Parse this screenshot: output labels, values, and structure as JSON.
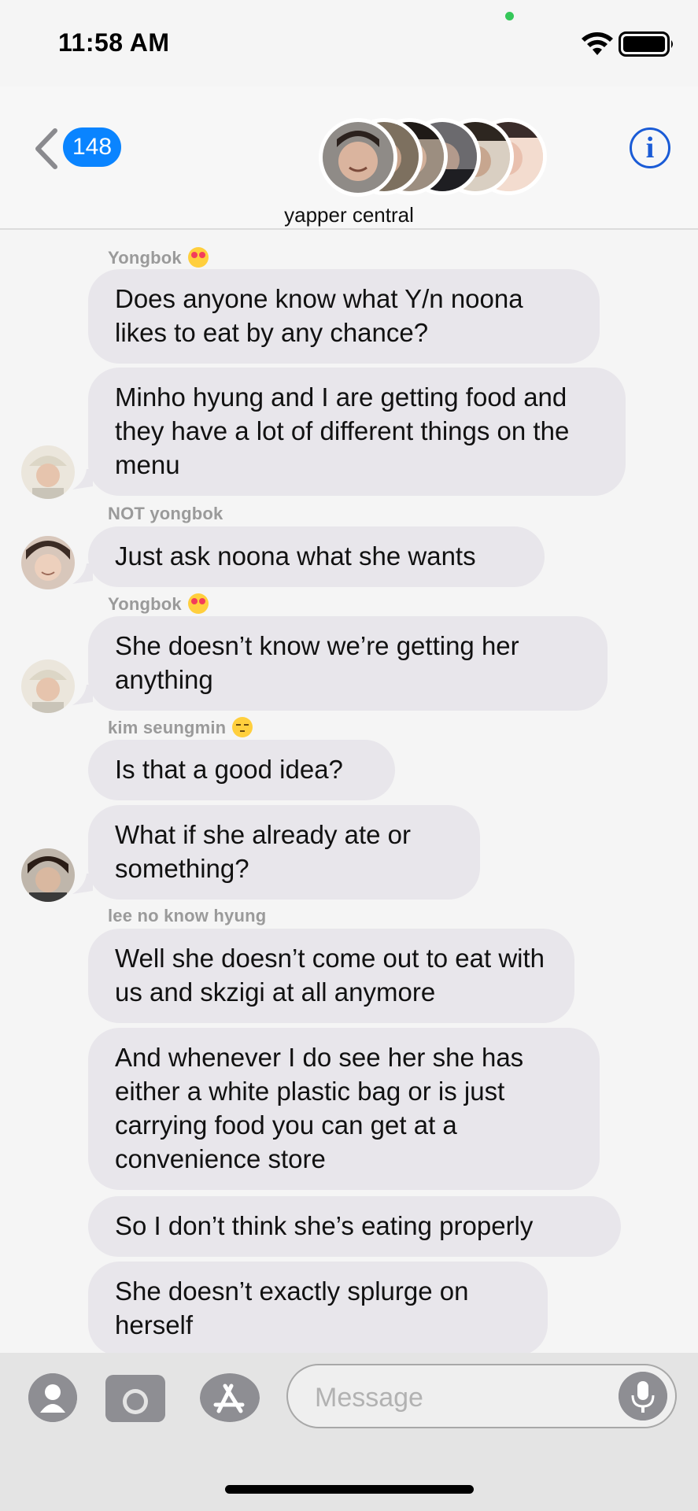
{
  "status": {
    "time": "11:58 AM",
    "battery_level": 1.0
  },
  "header": {
    "back_count": "148",
    "group_name": "yapper central",
    "info_label": "i"
  },
  "messages": [
    {
      "sender": "Yongbok",
      "sender_emoji": "smiling-face-with-hearts",
      "text": "Does anyone know what Y/n noona likes to eat by any chance?"
    },
    {
      "sender": "",
      "text": "Minho hyung and I are getting food and they have a lot of different things on the menu",
      "avatar": "yongbok-avatar"
    },
    {
      "sender": "NOT yongbok",
      "text": "Just ask noona what she wants",
      "avatar": "not-yongbok-avatar"
    },
    {
      "sender": "Yongbok",
      "sender_emoji": "smiling-face-with-hearts",
      "text": "She doesn’t know we’re getting her anything",
      "avatar": "yongbok-avatar"
    },
    {
      "sender": "kim seungmin",
      "sender_emoji": "unamused-face",
      "text": "Is that a good idea?"
    },
    {
      "sender": "",
      "text": "What if she already ate or something?",
      "avatar": "seungmin-avatar"
    },
    {
      "sender": "lee no know hyung",
      "text": "Well she doesn’t come out to eat with us and skzigi at all anymore"
    },
    {
      "sender": "",
      "text": "And whenever I do see her she has either a white plastic bag or is just carrying food you can get at a convenience store"
    },
    {
      "sender": "",
      "text": "So I don’t think she’s eating properly"
    },
    {
      "sender": "",
      "text": "She doesn’t exactly splurge on herself"
    }
  ],
  "composer": {
    "placeholder": "Message"
  },
  "colors": {
    "accent": "#0a84ff",
    "bubble": "#e8e6eb",
    "info": "#1a5bd6"
  }
}
